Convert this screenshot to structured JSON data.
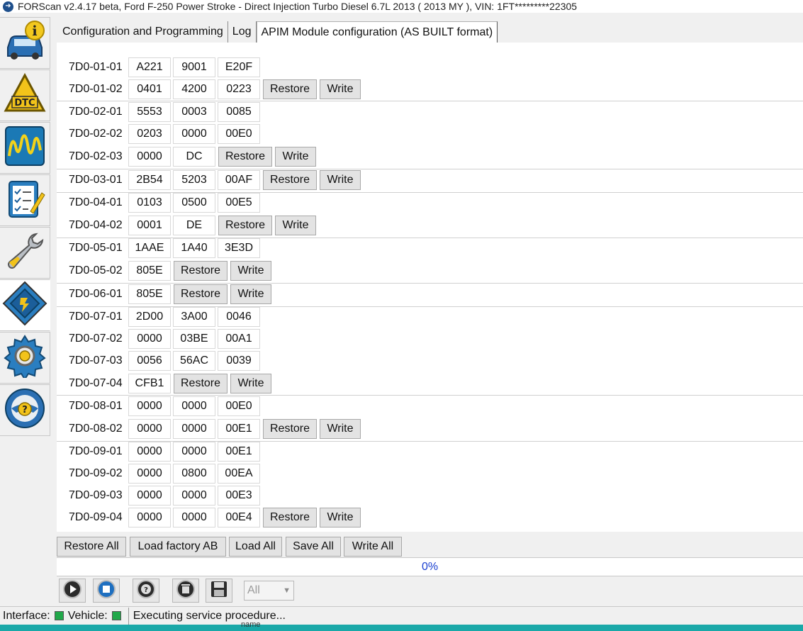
{
  "window": {
    "title": "FORScan v2.4.17 beta, Ford F-250 Power Stroke - Direct Injection Turbo Diesel 6.7L 2013 ( 2013 MY ), VIN: 1FT*********22305"
  },
  "sidebar": {
    "items": [
      {
        "icon": "vehicle-info-icon",
        "label": "Vehicle info"
      },
      {
        "icon": "dtc-icon",
        "label": "DTC"
      },
      {
        "icon": "oscilloscope-icon",
        "label": "Oscilloscope"
      },
      {
        "icon": "checklist-icon",
        "label": "Tests"
      },
      {
        "icon": "wrench-icon",
        "label": "Service functions"
      },
      {
        "icon": "module-config-icon",
        "label": "Configuration"
      },
      {
        "icon": "settings-gear-icon",
        "label": "Settings"
      },
      {
        "icon": "help-icon",
        "label": "Help"
      }
    ],
    "active_index": 5
  },
  "tabs": [
    {
      "label": "Configuration and Programming"
    },
    {
      "label": "Log"
    },
    {
      "label": "APIM Module configuration (AS BUILT format)",
      "active": true
    }
  ],
  "config_rows": [
    {
      "label": "7D0-01-01",
      "values": [
        "A221",
        "9001",
        "E20F"
      ],
      "restore": false
    },
    {
      "label": "7D0-01-02",
      "values": [
        "0401",
        "4200",
        "0223"
      ],
      "restore": true
    },
    {
      "label": "7D0-02-01",
      "values": [
        "5553",
        "0003",
        "0085"
      ],
      "restore": false
    },
    {
      "label": "7D0-02-02",
      "values": [
        "0203",
        "0000",
        "00E0"
      ],
      "restore": false
    },
    {
      "label": "7D0-02-03",
      "values": [
        "0000",
        "DC"
      ],
      "restore": true
    },
    {
      "label": "7D0-03-01",
      "values": [
        "2B54",
        "5203",
        "00AF"
      ],
      "restore": true
    },
    {
      "label": "7D0-04-01",
      "values": [
        "0103",
        "0500",
        "00E5"
      ],
      "restore": false
    },
    {
      "label": "7D0-04-02",
      "values": [
        "0001",
        "DE"
      ],
      "restore": true
    },
    {
      "label": "7D0-05-01",
      "values": [
        "1AAE",
        "1A40",
        "3E3D"
      ],
      "restore": false
    },
    {
      "label": "7D0-05-02",
      "values": [
        "805E"
      ],
      "restore": true
    },
    {
      "label": "7D0-06-01",
      "values": [
        "805E"
      ],
      "restore": true
    },
    {
      "label": "7D0-07-01",
      "values": [
        "2D00",
        "3A00",
        "0046"
      ],
      "restore": false
    },
    {
      "label": "7D0-07-02",
      "values": [
        "0000",
        "03BE",
        "00A1"
      ],
      "restore": false
    },
    {
      "label": "7D0-07-03",
      "values": [
        "0056",
        "56AC",
        "0039"
      ],
      "restore": false
    },
    {
      "label": "7D0-07-04",
      "values": [
        "CFB1"
      ],
      "restore": true
    },
    {
      "label": "7D0-08-01",
      "values": [
        "0000",
        "0000",
        "00E0"
      ],
      "restore": false
    },
    {
      "label": "7D0-08-02",
      "values": [
        "0000",
        "0000",
        "00E1"
      ],
      "restore": true
    },
    {
      "label": "7D0-09-01",
      "values": [
        "0000",
        "0000",
        "00E1"
      ],
      "restore": false
    },
    {
      "label": "7D0-09-02",
      "values": [
        "0000",
        "0800",
        "00EA"
      ],
      "restore": false
    },
    {
      "label": "7D0-09-03",
      "values": [
        "0000",
        "0000",
        "00E3"
      ],
      "restore": false
    },
    {
      "label": "7D0-09-04",
      "values": [
        "0000",
        "0000",
        "00E4"
      ],
      "restore": true
    }
  ],
  "row_buttons": {
    "restore_label": "Restore",
    "write_label": "Write"
  },
  "bottom_buttons": [
    {
      "label": "Restore All"
    },
    {
      "label": "Load factory AB"
    },
    {
      "label": "Load All"
    },
    {
      "label": "Save All"
    },
    {
      "label": "Write All"
    }
  ],
  "progress": {
    "percent": 0,
    "text": "0%"
  },
  "toolbar": {
    "tools": [
      "play-icon",
      "stop-icon",
      "lifebuoy-icon",
      "trash-icon",
      "save-icon"
    ],
    "filter_value": "All"
  },
  "statusbar": {
    "interface_label": "Interface:",
    "vehicle_label": "Vehicle:",
    "message": "Executing service procedure...",
    "led_color": "#21a84a"
  },
  "taskbar_hint": "name"
}
